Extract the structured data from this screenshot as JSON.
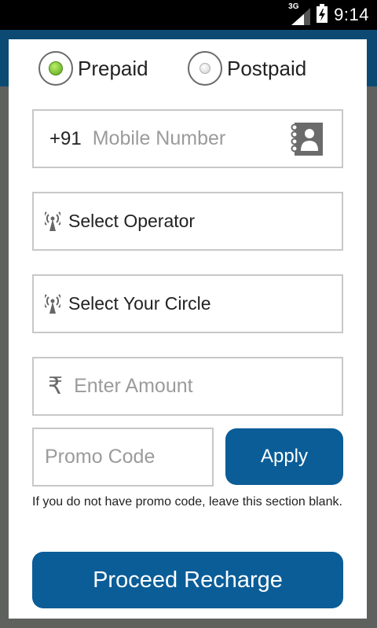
{
  "status_bar": {
    "network": "3G",
    "time": "9:14"
  },
  "plan_type": {
    "options": [
      {
        "label": "Prepaid",
        "selected": true
      },
      {
        "label": "Postpaid",
        "selected": false
      }
    ]
  },
  "mobile": {
    "prefix": "+91",
    "placeholder": "Mobile Number",
    "contacts_icon": "contact-book-icon"
  },
  "operator": {
    "label": "Select Operator",
    "icon": "tower-icon"
  },
  "circle": {
    "label": "Select Your Circle",
    "icon": "tower-icon"
  },
  "amount": {
    "currency_symbol": "₹",
    "placeholder": "Enter Amount"
  },
  "promo": {
    "placeholder": "Promo Code",
    "apply_label": "Apply",
    "note": "If you do not have promo code, leave this section blank."
  },
  "actions": {
    "proceed_label": "Proceed Recharge"
  },
  "colors": {
    "primary": "#0b5d97",
    "header": "#0c4a73",
    "selected_radio": "#6cc62a",
    "field_border": "#c8c8c8"
  }
}
